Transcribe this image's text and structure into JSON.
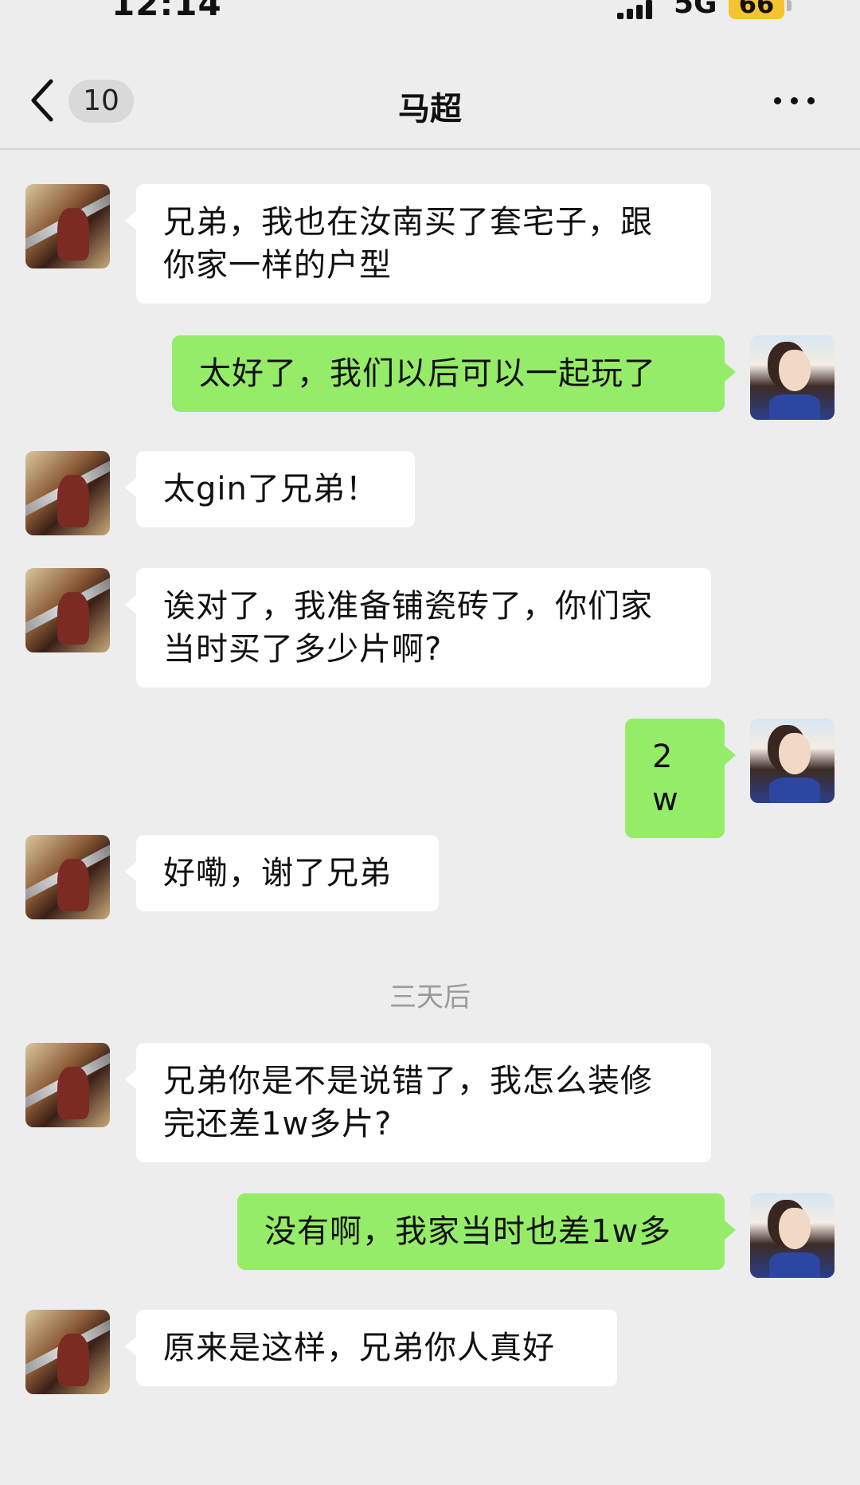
{
  "status_bar": {
    "time": "12:14",
    "network": "5G",
    "battery": "66"
  },
  "nav": {
    "unread_count": "10",
    "title": "马超"
  },
  "messages": [
    {
      "side": "left",
      "text": "兄弟，我也在汝南买了套宅子，跟你家一样的户型"
    },
    {
      "side": "right",
      "text": "太好了，我们以后可以一起玩了"
    },
    {
      "side": "left",
      "text": "太gin了兄弟！"
    },
    {
      "side": "left",
      "text": "诶对了，我准备铺瓷砖了，你们家当时买了多少片啊?"
    },
    {
      "side": "right",
      "text": "2w"
    },
    {
      "side": "left",
      "text": "好嘞，谢了兄弟"
    },
    {
      "side": "left",
      "text": "兄弟你是不是说错了，我怎么装修完还差1w多片?"
    },
    {
      "side": "right",
      "text": "没有啊，我家当时也差1w多"
    },
    {
      "side": "left",
      "text": "原来是这样，兄弟你人真好"
    }
  ],
  "time_divider": "三天后"
}
